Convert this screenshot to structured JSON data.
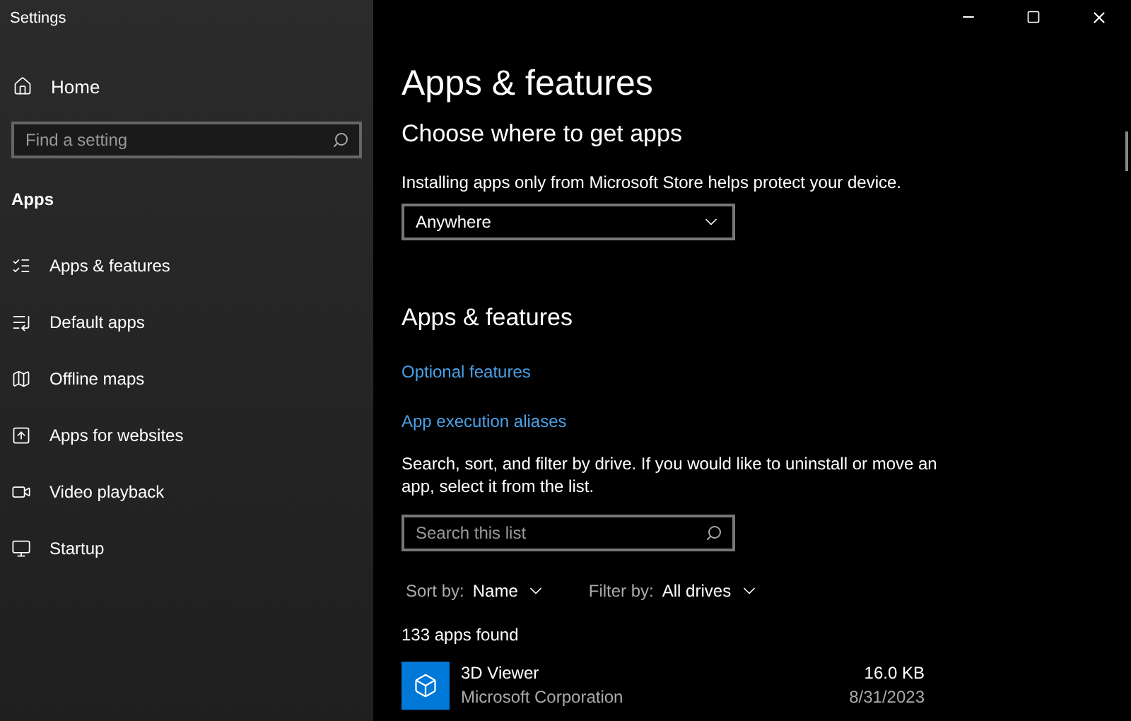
{
  "window": {
    "title": "Settings"
  },
  "sidebar": {
    "home": "Home",
    "search": {
      "placeholder": "Find a setting"
    },
    "section": "Apps",
    "items": [
      {
        "label": "Apps & features",
        "kind": "list"
      },
      {
        "label": "Default apps",
        "kind": "defaults"
      },
      {
        "label": "Offline maps",
        "kind": "map"
      },
      {
        "label": "Apps for websites",
        "kind": "web"
      },
      {
        "label": "Video playback",
        "kind": "video"
      },
      {
        "label": "Startup",
        "kind": "startup"
      }
    ]
  },
  "main": {
    "title": "Apps & features",
    "source": {
      "heading": "Choose where to get apps",
      "description": "Installing apps only from Microsoft Store helps protect your device.",
      "dropdown": "Anywhere"
    },
    "features": {
      "heading": "Apps & features",
      "links": [
        "Optional features",
        "App execution aliases"
      ],
      "description": "Search, sort, and filter by drive. If you would like to uninstall or move an app, select it from the list.",
      "search": {
        "placeholder": "Search this list"
      },
      "sort": {
        "label": "Sort by:",
        "value": "Name"
      },
      "filter": {
        "label": "Filter by:",
        "value": "All drives"
      },
      "count": "133 apps found",
      "apps": [
        {
          "name": "3D Viewer",
          "publisher": "Microsoft Corporation",
          "size": "16.0 KB",
          "date": "8/31/2023"
        }
      ]
    }
  }
}
